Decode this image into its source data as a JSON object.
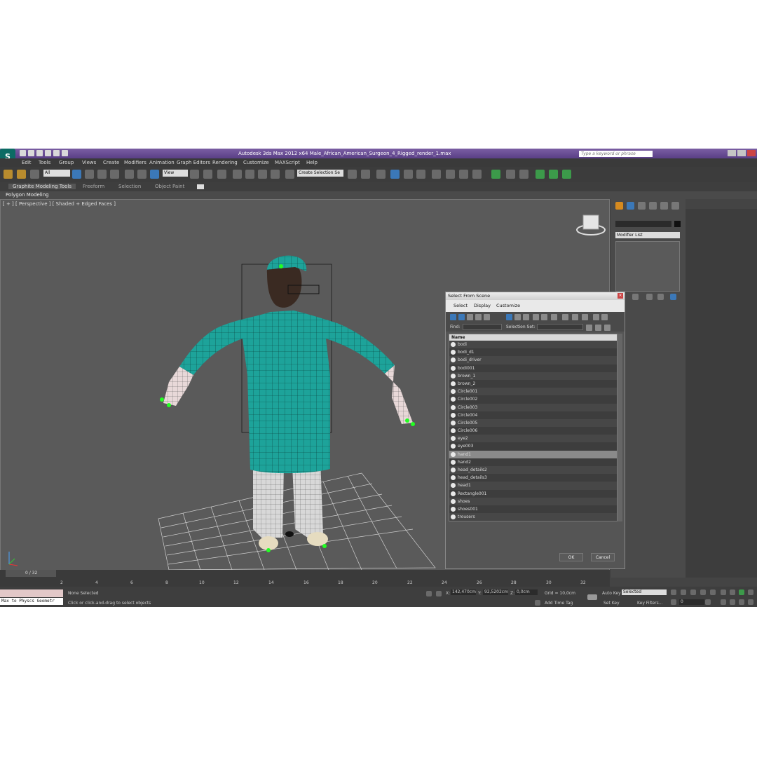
{
  "app": {
    "title": "Autodesk 3ds Max  2012 x64     Male_African_American_Surgeon_4_Rigged_render_1.max",
    "logo": "S",
    "search_placeholder": "Type a keyword or phrase"
  },
  "menu": [
    "Edit",
    "Tools",
    "Group",
    "Views",
    "Create",
    "Modifiers",
    "Animation",
    "Graph Editors",
    "Rendering",
    "Customize",
    "MAXScript",
    "Help"
  ],
  "toolbar": {
    "selection_filter": "All",
    "ref_coord": "View",
    "named_selection": "Create Selection Se"
  },
  "ribbon": {
    "tabs": [
      "Graphite Modeling Tools",
      "Freeform",
      "Selection",
      "Object Paint"
    ],
    "sub_label": "Polygon Modeling"
  },
  "viewport": {
    "label": "[ + ] [ Perspective ] [ Shaded + Edged Faces ]"
  },
  "command_panel": {
    "modifier_list": "Modifier List"
  },
  "dialog": {
    "title": "Select From Scene",
    "menu": [
      "Select",
      "Display",
      "Customize"
    ],
    "find_label": "Find:",
    "selection_set_label": "Selection Set:",
    "column_name": "Name",
    "items": [
      "bodi",
      "bodi_d1",
      "bodi_driver",
      "bodi001",
      "brown_1",
      "brown_2",
      "Circle001",
      "Circle002",
      "Circle003",
      "Circle004",
      "Circle005",
      "Circle006",
      "eye2",
      "eye003",
      "hand1",
      "hand2",
      "head_details2",
      "head_details3",
      "head1",
      "Rectangle001",
      "shoes",
      "shoes001",
      "trousers"
    ],
    "selected_item": "hand1",
    "ok": "OK",
    "cancel": "Cancel"
  },
  "timeline": {
    "frame_counter": "0 / 32",
    "ticks": [
      "2",
      "4",
      "6",
      "8",
      "10",
      "12",
      "14",
      "16",
      "18",
      "20",
      "22",
      "24",
      "26",
      "28",
      "30",
      "32"
    ]
  },
  "status": {
    "maxscript": "Max to Physcs Geometr",
    "selection": "None Selected",
    "prompt": "Click or click-and-drag to select objects",
    "x_label": "X:",
    "x_value": "142,470cm",
    "y_label": "Y:",
    "y_value": "92,5202cm",
    "z_label": "Z:",
    "z_value": "0,0cm",
    "grid": "Grid = 10,0cm",
    "add_time_tag": "Add Time Tag",
    "auto_key": "Auto Key",
    "set_key": "Set Key",
    "key_mode": "Selected",
    "key_filters": "Key Filters...",
    "frame": "0"
  }
}
